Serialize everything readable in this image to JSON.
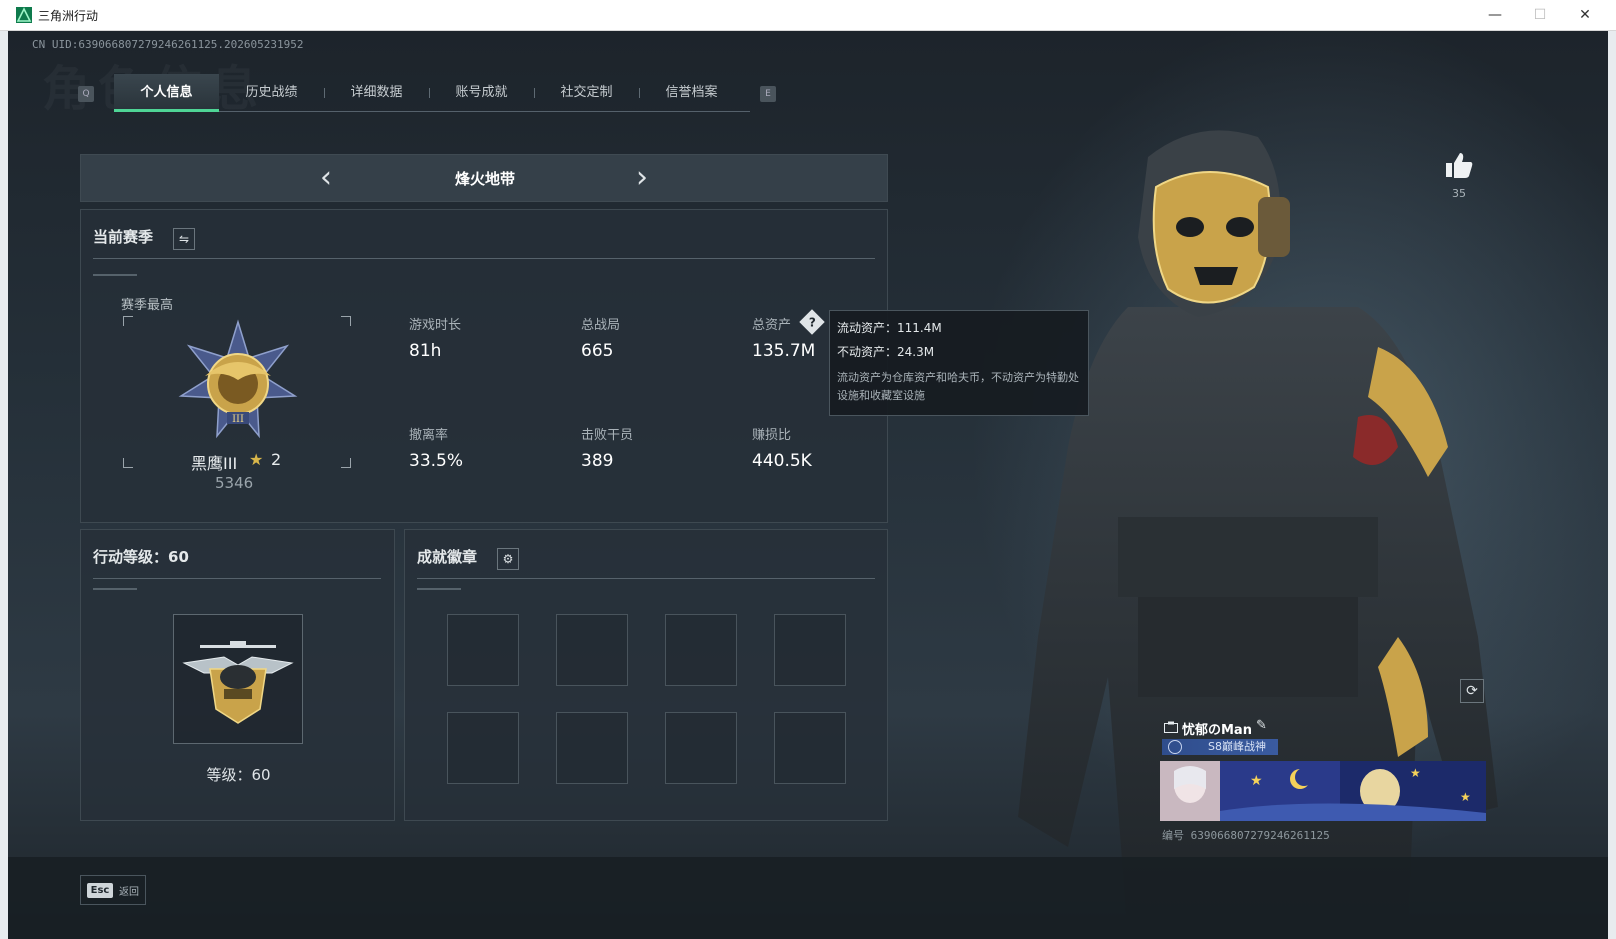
{
  "window": {
    "title": "三角洲行动"
  },
  "header": {
    "uid": "CN UID:6390668072792462611​25.202605231952",
    "watermark": "角色信息"
  },
  "tabs": [
    {
      "label": "个人信息",
      "active": true
    },
    {
      "label": "历史战绩"
    },
    {
      "label": "详细数据"
    },
    {
      "label": "账号成就"
    },
    {
      "label": "社交定制"
    },
    {
      "label": "信誉档案"
    }
  ],
  "key_hints": {
    "prev": "Q",
    "next": "E"
  },
  "mode": {
    "title": "烽火地带"
  },
  "season": {
    "title": "当前赛季",
    "best_label": "赛季最高",
    "rank_name": "黑鹰III",
    "rank_stars": "2",
    "rank_score": "5346",
    "stats": [
      {
        "label": "游戏时长",
        "value": "81h"
      },
      {
        "label": "总战局",
        "value": "665"
      },
      {
        "label": "总资产",
        "value": "135.7M"
      },
      {
        "label": "撤离率",
        "value": "33.5%"
      },
      {
        "label": "击败干员",
        "value": "389"
      },
      {
        "label": "赚损比",
        "value": "440.5K"
      }
    ]
  },
  "tooltip": {
    "liquid": "流动资产：111.4M",
    "fixed": "不动资产：24.3M",
    "note": "流动资产为仓库资产和哈夫币，不动资产为特勤处设施和收藏室设施"
  },
  "level": {
    "title": "行动等级：60",
    "text": "等级：60"
  },
  "achievements": {
    "title": "成就徽章"
  },
  "profile": {
    "likes": "35",
    "name": "忧郁のMan",
    "title_badge": "S8巅峰战神",
    "id": "编号 639066807279246261125"
  },
  "footer": {
    "esc_key": "Esc",
    "esc_label": "返回"
  },
  "colors": {
    "accent": "#4fd596",
    "gold": "#c9a34a",
    "panel": "#263038"
  }
}
